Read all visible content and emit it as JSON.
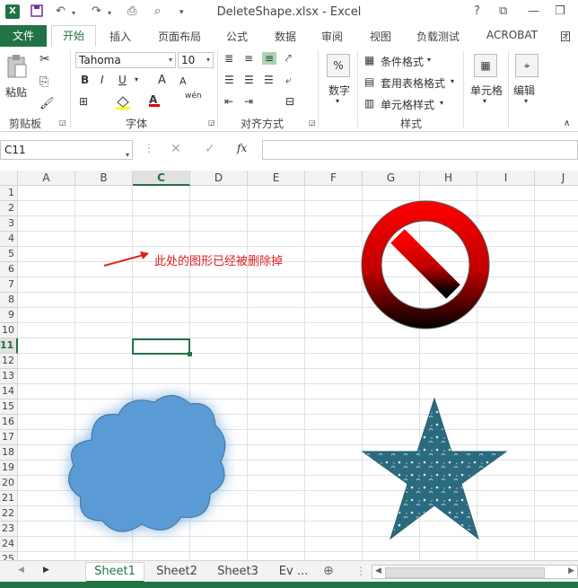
{
  "window": {
    "title": "DeleteShape.xlsx - Excel",
    "help": "?",
    "app_icon": "X"
  },
  "tabs": [
    "文件",
    "开始",
    "插入",
    "页面布局",
    "公式",
    "数据",
    "审阅",
    "视图",
    "负载测试",
    "ACROBAT",
    "团队"
  ],
  "ribbon": {
    "clipboard": {
      "paste": "粘贴",
      "group": "剪贴板"
    },
    "font": {
      "name": "Tahoma",
      "size": "10",
      "group": "字体",
      "bold": "B",
      "italic": "I",
      "underline": "U",
      "grow": "A",
      "shrink": "A",
      "phonetic": "wén"
    },
    "align": {
      "group": "对齐方式"
    },
    "number": {
      "label": "数字",
      "percent": "%"
    },
    "styles": {
      "conditional": "条件格式",
      "table": "套用表格格式",
      "cell": "单元格样式",
      "group": "样式"
    },
    "cells": {
      "label": "单元格"
    },
    "editing": {
      "label": "编辑"
    }
  },
  "formula_bar": {
    "name_box": "C11",
    "fx": "fx",
    "formula": ""
  },
  "grid": {
    "columns": [
      "A",
      "B",
      "C",
      "D",
      "E",
      "F",
      "G",
      "H",
      "I",
      "J"
    ],
    "rows": [
      "1",
      "2",
      "3",
      "4",
      "5",
      "6",
      "7",
      "8",
      "9",
      "10",
      "11",
      "12",
      "13",
      "14",
      "15",
      "16",
      "17",
      "18",
      "19",
      "20",
      "21",
      "22",
      "23",
      "24",
      "25"
    ],
    "selected_cell": "C11",
    "annotation": "此处的图形已经被删除掉"
  },
  "sheets": [
    "Sheet1",
    "Sheet2",
    "Sheet3",
    "Ev ..."
  ],
  "active_sheet": "Sheet1",
  "colors": {
    "accent": "#217346",
    "arrow": "#e02020",
    "cloud": "#5b9bd5",
    "star": "#2a6b80",
    "no_sign": "#e00000"
  }
}
